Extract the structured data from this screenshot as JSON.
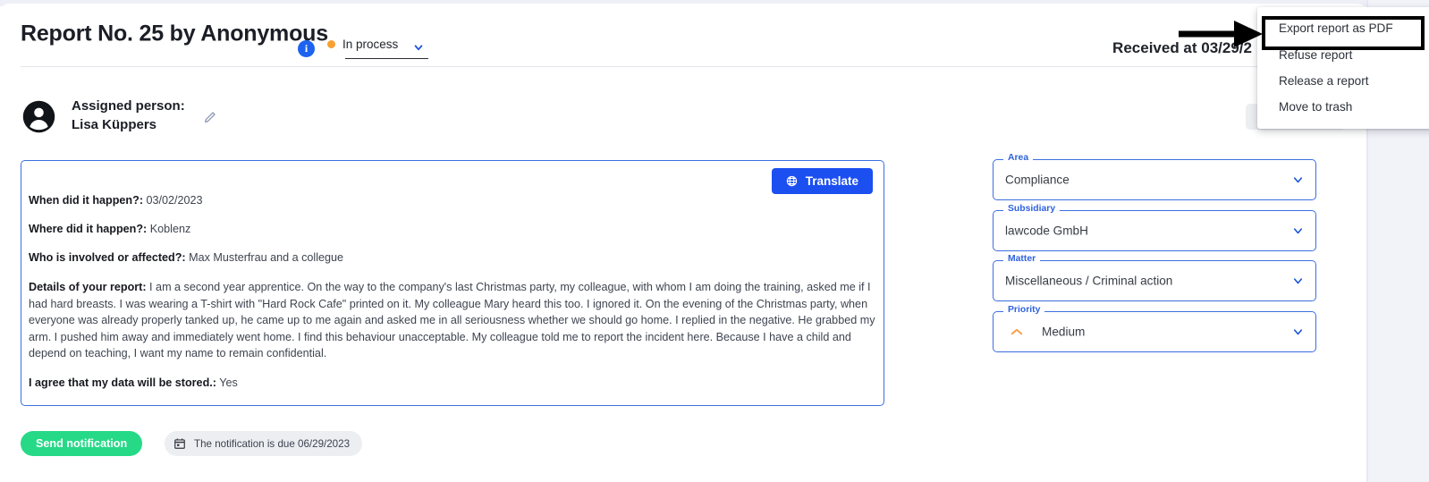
{
  "header": {
    "title": "Report No. 25 by Anonymous",
    "info_icon": "info-icon",
    "status": {
      "label": "In process",
      "dot_color": "#f7a030",
      "chevron_icon": "chevron-down-icon"
    },
    "received": "Received at 03/29/2"
  },
  "assigned": {
    "label": "Assigned person:",
    "name": "Lisa Küppers",
    "avatar_icon": "user-avatar-icon",
    "edit_icon": "pencil-icon"
  },
  "report": {
    "translate_label": "Translate",
    "translate_icon": "globe-icon",
    "fields": [
      {
        "label": "When did it happen?:",
        "value": " 03/02/2023"
      },
      {
        "label": "Where did it happen?:",
        "value": " Koblenz"
      },
      {
        "label": "Who is involved or affected?:",
        "value": " Max Musterfrau and a collegue"
      },
      {
        "label": "Details of your report:",
        "value": " I am a second year apprentice. On the way to the company's last Christmas party, my colleague, with whom I am doing the training, asked me if I had hard breasts. I was wearing a T-shirt with \"Hard Rock Cafe\" printed on it. My colleague Mary heard this too. I ignored it. On the evening of the Christmas party, when everyone was already properly tanked up, he came up to me again and asked me in all seriousness whether we should go home. I replied in the negative. He grabbed my arm. I pushed him away and immediately went home. I find this behaviour unacceptable. My colleague told me to report the incident here. Because I have a child and depend on teaching, I want my name to remain confidential."
      },
      {
        "label": "I agree that my data will be stored.:",
        "value": " Yes"
      }
    ]
  },
  "actions": {
    "send_notification": "Send notification",
    "due_chip": "The notification is due 06/29/2023",
    "calendar_icon": "calendar-icon"
  },
  "form": {
    "area": {
      "legend": "Area",
      "value": "Compliance",
      "chevron_icon": "chevron-down-icon"
    },
    "subsidiary": {
      "legend": "Subsidiary",
      "value": "lawcode GmbH",
      "chevron_icon": "chevron-down-icon"
    },
    "matter": {
      "legend": "Matter",
      "value": "Miscellaneous / Criminal action",
      "chevron_icon": "chevron-down-icon"
    },
    "priority": {
      "legend": "Priority",
      "value": "Medium",
      "icon": "chevron-up-icon",
      "icon_color": "#f5a04a",
      "chevron_icon": "chevron-down-icon"
    }
  },
  "context_menu": {
    "items": [
      {
        "label": "Export report as PDF"
      },
      {
        "label": "Refuse report"
      },
      {
        "label": "Release a report"
      },
      {
        "label": "Move to trash"
      }
    ]
  },
  "annotations": {
    "highlight_target": "Export report as PDF",
    "arrow_icon": "pointer-arrow-annotation"
  },
  "colors": {
    "accent_blue": "#1b4ff0",
    "field_border_blue": "#3b6fe0",
    "success_green": "#25d987",
    "status_orange": "#f7a030",
    "priority_orange": "#f5a04a"
  }
}
